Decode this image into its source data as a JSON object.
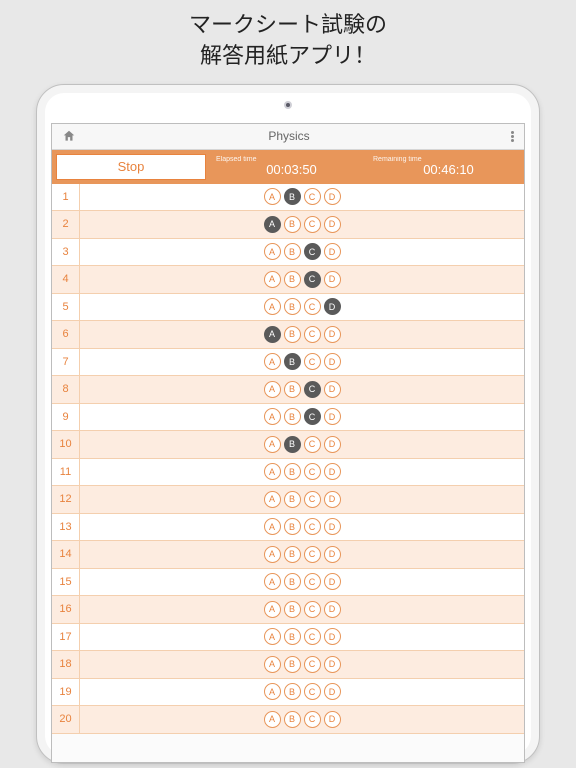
{
  "promo": {
    "line1": "マークシート試験の",
    "line2": "解答用紙アプリ！"
  },
  "header": {
    "title": "Physics"
  },
  "timer": {
    "stop_label": "Stop",
    "elapsed_label": "Elapsed time",
    "elapsed_value": "00:03:50",
    "remaining_label": "Remaining time",
    "remaining_value": "00:46:10"
  },
  "options": [
    "A",
    "B",
    "C",
    "D"
  ],
  "questions": [
    {
      "num": 1,
      "selected": "B"
    },
    {
      "num": 2,
      "selected": "A"
    },
    {
      "num": 3,
      "selected": "C"
    },
    {
      "num": 4,
      "selected": "C"
    },
    {
      "num": 5,
      "selected": "D"
    },
    {
      "num": 6,
      "selected": "A"
    },
    {
      "num": 7,
      "selected": "B"
    },
    {
      "num": 8,
      "selected": "C"
    },
    {
      "num": 9,
      "selected": "C"
    },
    {
      "num": 10,
      "selected": "B"
    },
    {
      "num": 11,
      "selected": null
    },
    {
      "num": 12,
      "selected": null
    },
    {
      "num": 13,
      "selected": null
    },
    {
      "num": 14,
      "selected": null
    },
    {
      "num": 15,
      "selected": null
    },
    {
      "num": 16,
      "selected": null
    },
    {
      "num": 17,
      "selected": null
    },
    {
      "num": 18,
      "selected": null
    },
    {
      "num": 19,
      "selected": null
    },
    {
      "num": 20,
      "selected": null
    }
  ]
}
